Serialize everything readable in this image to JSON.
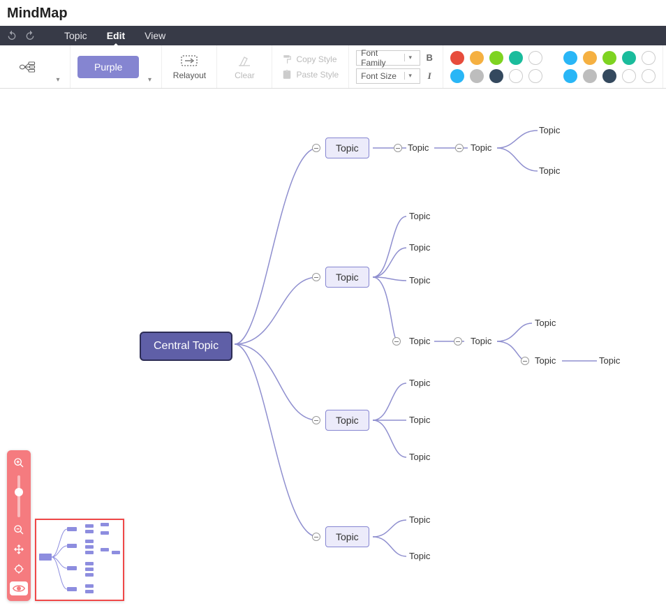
{
  "app": {
    "title": "MindMap"
  },
  "menu": {
    "undo_tip": "Undo",
    "redo_tip": "Redo",
    "items": [
      {
        "label": "Topic",
        "active": false
      },
      {
        "label": "Edit",
        "active": true
      },
      {
        "label": "View",
        "active": false
      }
    ]
  },
  "toolbar": {
    "theme_button": "Purple",
    "relayout": "Relayout",
    "clear": "Clear",
    "copy_style": "Copy Style",
    "paste_style": "Paste Style",
    "font_family": "Font Family",
    "font_size": "Font Size",
    "bold": "B",
    "italic": "I",
    "palette_top": [
      "#e74c3c",
      "#f5b041",
      "#7ed321",
      "#1abc9c",
      "#ffffff",
      "#29b6f6",
      "#f5b041",
      "#7ed321",
      "#1abc9c",
      "#ffffff"
    ],
    "palette_bottom": [
      "#29b6f6",
      "#bdbdbd",
      "#34495e",
      "#ffffff",
      "#ffffff",
      "#29b6f6",
      "#bdbdbd",
      "#34495e",
      "#ffffff",
      "#ffffff"
    ]
  },
  "nodes": {
    "central": "Central Topic",
    "l1": [
      "Topic",
      "Topic",
      "Topic",
      "Topic"
    ],
    "branch1_chain": [
      "Topic",
      "Topic"
    ],
    "branch1_leaf": [
      "Topic",
      "Topic"
    ],
    "branch2_children": [
      "Topic",
      "Topic",
      "Topic",
      "Topic"
    ],
    "branch2_sub_chain": [
      "Topic"
    ],
    "branch2_sub_leaf": [
      "Topic",
      "Topic"
    ],
    "branch3_children": [
      "Topic",
      "Topic",
      "Topic"
    ],
    "branch4_children": [
      "Topic",
      "Topic"
    ]
  }
}
